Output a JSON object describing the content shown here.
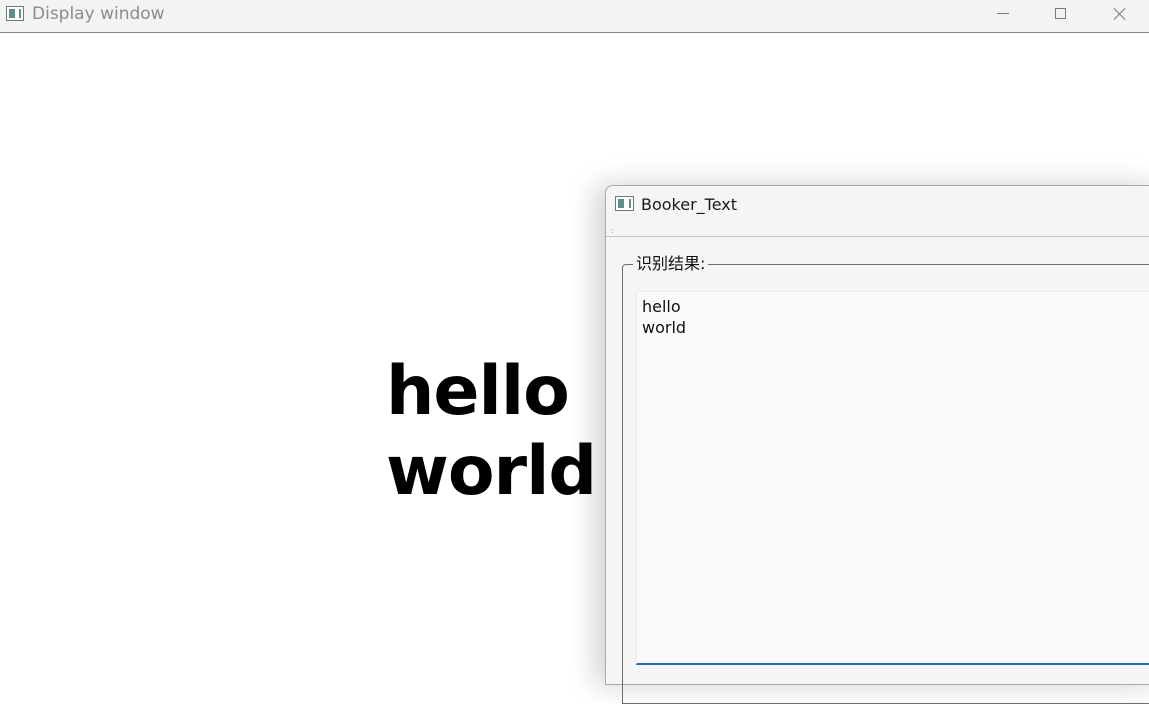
{
  "display_window": {
    "title": "Display window",
    "canvas_text": "hello\nworld",
    "controls": {
      "minimize_icon": "minimize-icon",
      "maximize_icon": "maximize-icon",
      "close_icon": "close-icon"
    }
  },
  "booker_window": {
    "title": "Booker_Text",
    "group_label": "识别结果:",
    "result_text": "hello\nworld"
  },
  "colors": {
    "focus_accent": "#1f6fb5",
    "app_icon": "#5e8f8a"
  }
}
